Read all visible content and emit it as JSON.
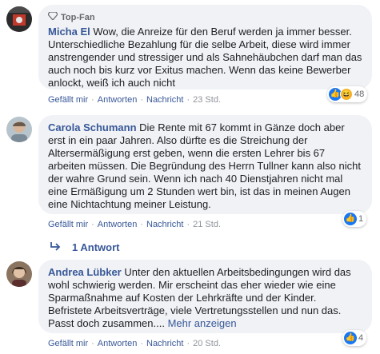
{
  "comments": [
    {
      "badge": "Top-Fan",
      "author": "Micha El",
      "text": "Wow, die Anreize für den Beruf werden ja immer besser. Unterschiedliche Bezahlung für die selbe Arbeit, diese wird immer anstrengender und stressiger und als Sahnehäubchen darf man das auch noch bis kurz vor Exitus machen. Wenn das keine Bewerber anlockt, weiß ich auch nicht",
      "actions": {
        "like": "Gefällt mir",
        "reply": "Antworten",
        "message": "Nachricht",
        "time": "23 Std."
      },
      "reaction_count": "48",
      "reactions": [
        "like-icon",
        "haha-icon"
      ]
    },
    {
      "author": "Carola Schumann",
      "text": "Die Rente mit 67 kommt in Gänze doch aber erst in ein paar Jahren. Also dürfte es die Streichung der Altersermäßigung erst geben, wenn die ersten Lehrer bis 67 arbeiten müssen. Die Begründung des Herrn Tullner kann also nicht der wahre Grund sein. Wenn ich nach 40 Dienstjahren nicht mal eine Ermäßigung um 2 Stunden wert bin, ist das in meinen Augen eine Nichtachtung meiner Leistung.",
      "actions": {
        "like": "Gefällt mir",
        "reply": "Antworten",
        "message": "Nachricht",
        "time": "21 Std."
      },
      "reaction_count": "1",
      "reactions": [
        "like-icon"
      ],
      "replies_label": "1 Antwort"
    },
    {
      "author": "Andrea Lübker",
      "text": "Unter den aktuellen Arbeitsbedingungen wird das wohl schwierig werden. Mir erscheint das eher wieder wie eine Sparmaßnahme auf Kosten der Lehrkräfte und der Kinder. Befristete Arbeitsverträge, viele Vertretungsstellen und nun das. Passt doch zusammen....",
      "more_label": "Mehr anzeigen",
      "actions": {
        "like": "Gefällt mir",
        "reply": "Antworten",
        "message": "Nachricht",
        "time": "20 Std."
      },
      "reaction_count": "4",
      "reactions": [
        "like-icon"
      ]
    }
  ],
  "colors": {
    "link": "#385898",
    "bubble": "#f0f2f5",
    "like": "#1877f2"
  }
}
